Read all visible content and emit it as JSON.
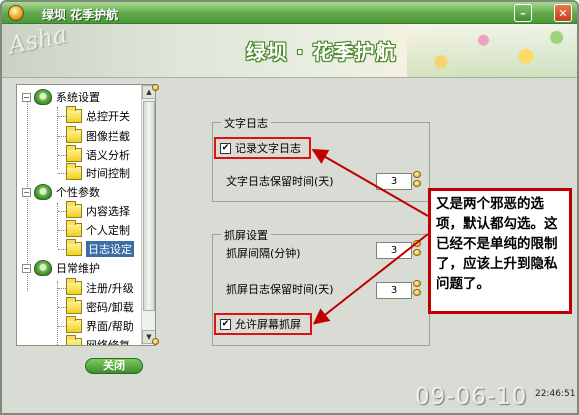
{
  "window": {
    "title": "绿坝 花季护航"
  },
  "banner": {
    "logo_text": "绿坝 · 花季护航",
    "signature": "Asha"
  },
  "tree": {
    "groups": [
      {
        "label": "系统设置",
        "children": [
          "总控开关",
          "图像拦截",
          "语义分析",
          "时间控制"
        ]
      },
      {
        "label": "个性参数",
        "children": [
          "内容选择",
          "个人定制",
          "日志设定"
        ]
      },
      {
        "label": "日常维护",
        "children": [
          "注册/升级",
          "密码/卸载",
          "界面/帮助",
          "网络修复"
        ]
      }
    ],
    "selected": "日志设定"
  },
  "close_button": "关闭",
  "text_log": {
    "title": "文字日志",
    "checkbox_label": "记录文字日志",
    "checked": true,
    "retention_label": "文字日志保留时间(天)",
    "retention_value": "3"
  },
  "screen_capture": {
    "title": "抓屏设置",
    "interval_label": "抓屏间隔(分钟)",
    "interval_value": "3",
    "retention_label": "抓屏日志保留时间(天)",
    "retention_value": "3",
    "checkbox_label": "允许屏幕抓屏",
    "checked": true
  },
  "annotation": {
    "text": "又是两个邪恶的选项，默认都勾选。这已经不是单纯的限制了，应该上升到隐私问题了。",
    "color": "#c00000"
  },
  "status": {
    "time": "22:46:51",
    "date_watermark": "09-06-10"
  }
}
